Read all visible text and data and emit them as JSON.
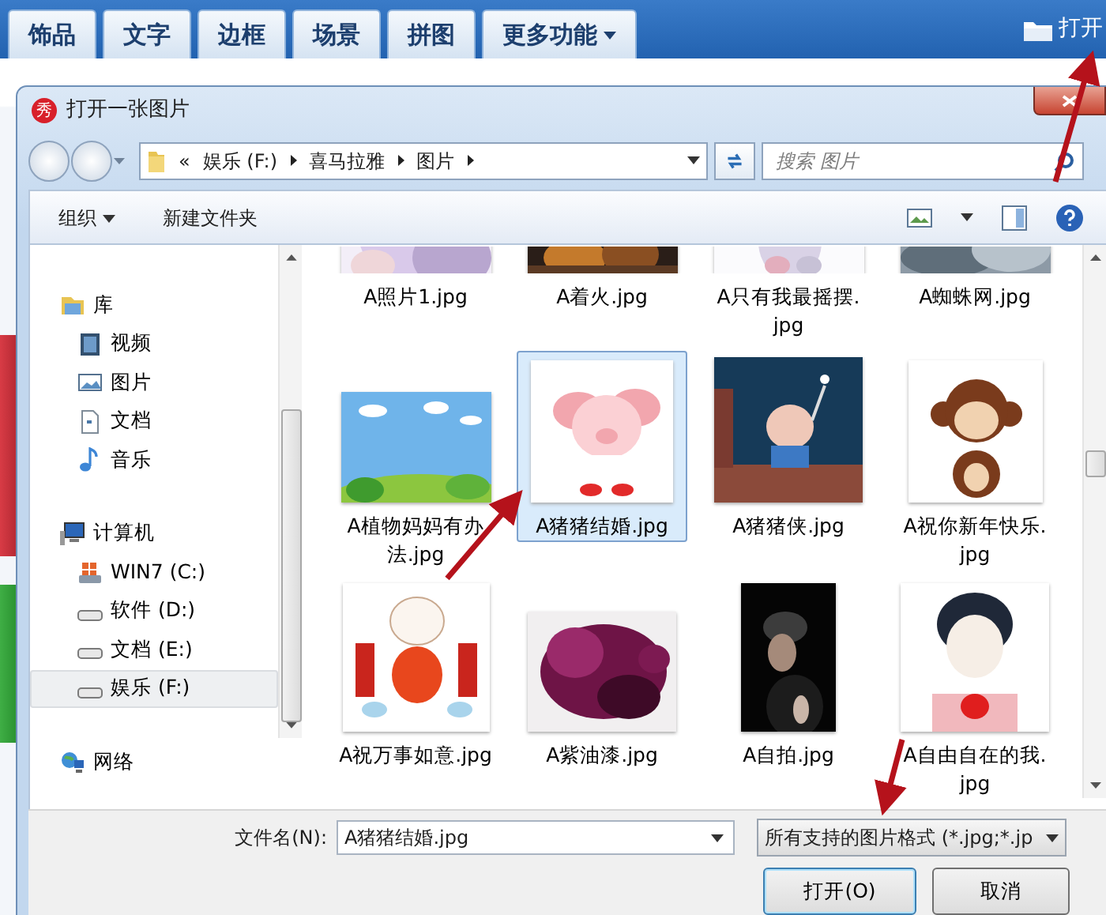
{
  "app_bar": {
    "tabs": [
      {
        "label": "饰品",
        "kind": "tab"
      },
      {
        "label": "文字",
        "kind": "tab"
      },
      {
        "label": "边框",
        "kind": "tab"
      },
      {
        "label": "场景",
        "kind": "tab"
      },
      {
        "label": "拼图",
        "kind": "tab"
      },
      {
        "label": "更多功能",
        "kind": "menu"
      }
    ],
    "open_button": "打开"
  },
  "dialog": {
    "icon_text": "秀",
    "title": "打开一张图片",
    "address": {
      "overflow": "«",
      "path": [
        "娱乐 (F:)",
        "喜马拉雅",
        "图片"
      ]
    },
    "search": {
      "placeholder": "搜索 图片"
    },
    "toolbar": {
      "organize": "组织",
      "new_folder": "新建文件夹"
    },
    "navigation": [
      {
        "label": "库",
        "kind": "library",
        "selected": false,
        "children": [
          {
            "label": "视频",
            "kind": "video",
            "selected": false
          },
          {
            "label": "图片",
            "kind": "pictures",
            "selected": false
          },
          {
            "label": "文档",
            "kind": "documents",
            "selected": false
          },
          {
            "label": "音乐",
            "kind": "music",
            "selected": false
          }
        ]
      },
      {
        "label": "计算机",
        "kind": "computer",
        "selected": false,
        "children": [
          {
            "label": "WIN7 (C:)",
            "kind": "system-drive",
            "selected": false
          },
          {
            "label": "软件 (D:)",
            "kind": "drive",
            "selected": false
          },
          {
            "label": "文档 (E:)",
            "kind": "drive",
            "selected": false
          },
          {
            "label": "娱乐 (F:)",
            "kind": "drive",
            "selected": true
          }
        ]
      },
      {
        "label": "网络",
        "kind": "network",
        "selected": false
      }
    ],
    "files": [
      {
        "lines": [
          "A照片1.jpg"
        ],
        "selected": false,
        "partly_hidden": true
      },
      {
        "lines": [
          "A着火.jpg"
        ],
        "selected": false,
        "partly_hidden": true
      },
      {
        "lines": [
          "A只有我最摇摆.",
          "jpg"
        ],
        "selected": false,
        "partly_hidden": true
      },
      {
        "lines": [
          "A蜘蛛网.jpg"
        ],
        "selected": false,
        "partly_hidden": true
      },
      {
        "lines": [
          "A植物妈妈有办",
          "法.jpg"
        ],
        "selected": false,
        "partly_hidden": false
      },
      {
        "lines": [
          "A猪猪结婚.jpg"
        ],
        "selected": true,
        "partly_hidden": false
      },
      {
        "lines": [
          "A猪猪侠.jpg"
        ],
        "selected": false,
        "partly_hidden": false
      },
      {
        "lines": [
          "A祝你新年快乐.",
          "jpg"
        ],
        "selected": false,
        "partly_hidden": false
      },
      {
        "lines": [
          "A祝万事如意.jpg"
        ],
        "selected": false,
        "partly_hidden": false
      },
      {
        "lines": [
          "A紫油漆.jpg"
        ],
        "selected": false,
        "partly_hidden": false
      },
      {
        "lines": [
          "A自拍.jpg"
        ],
        "selected": false,
        "partly_hidden": false
      },
      {
        "lines": [
          "A自由自在的我.",
          "jpg"
        ],
        "selected": false,
        "partly_hidden": false
      }
    ],
    "file_name": {
      "label": "文件名(N):",
      "value": "A猪猪结婚.jpg"
    },
    "file_type": "所有支持的图片格式 (*.jpg;*.jp",
    "buttons": [
      {
        "label": "打开(O)",
        "kind": "primary"
      },
      {
        "label": "取消",
        "kind": "secondary"
      }
    ]
  }
}
